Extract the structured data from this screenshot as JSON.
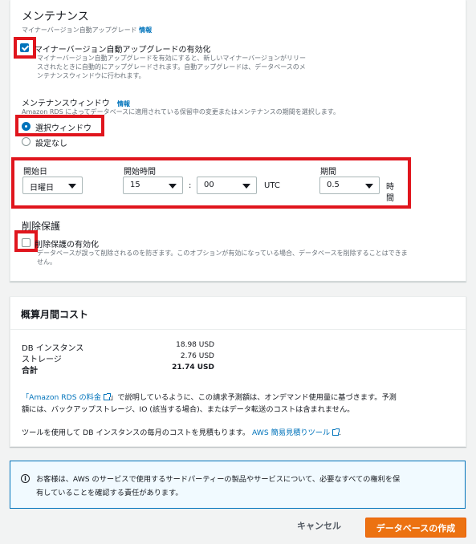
{
  "maintenance": {
    "title": "メンテナンス",
    "subtitle": "マイナーバージョン自動アップグレード",
    "info_link": "情報",
    "auto_upgrade": {
      "label": "マイナーバージョン自動アップグレードの有効化",
      "checked": true,
      "desc_line1": "マイナーバージョン自動アップグレードを有効にすると、新しいマイナーバージョンがリリー",
      "desc_line2": "スされたときに自動的にアップグレードされます。自動アップグレードは、データベースのメ",
      "desc_line3": "ンテナンスウィンドウに行われます。"
    },
    "window": {
      "title": "メンテナンスウィンドウ",
      "info_link": "情報",
      "desc": "Amazon RDS によってデータベースに適用されている保留中の変更またはメンテナンスの期間を選択します。",
      "option_select": "選択ウィンドウ",
      "option_none": "設定なし",
      "selected": "選択ウィンドウ"
    },
    "schedule": {
      "start_day_label": "開始日",
      "start_day_value": "日曜日",
      "start_time_label": "開始時間",
      "hour_value": "15",
      "separator": ":",
      "minute_value": "00",
      "timezone": "UTC",
      "duration_label": "期間",
      "duration_value": "0.5",
      "duration_unit_1": "時",
      "duration_unit_2": "間"
    }
  },
  "deletion": {
    "title": "削除保護",
    "label": "削除保護の有効化",
    "checked": false,
    "desc_line1": "データベースが誤って削除されるのを防ぎます。このオプションが有効になっている場合、データベースを削除することはできま",
    "desc_line2": "せん。"
  },
  "cost": {
    "title": "概算月間コスト",
    "rows": [
      {
        "label": "DB インスタンス",
        "value": "18.98 USD"
      },
      {
        "label": "ストレージ",
        "value": "2.76 USD"
      },
      {
        "label": "合計",
        "value": "21.74 USD"
      }
    ],
    "pricing_link": "「Amazon RDS の料金",
    "text_line1_rest": "」で説明しているように、この請求予測額は、オンデマンド使用量に基づきます。予測",
    "text_line2": "額には、バックアップストレージ、IO (該当する場合)、またはデータ転送のコストは含まれません。",
    "calculator_prefix": "ツールを使用して DB インスタンスの毎月のコストを見積もります。",
    "calculator_link": "AWS 簡易見積りツール",
    "calculator_suffix": "."
  },
  "notice": {
    "line1": "お客様は、AWS のサービスで使用するサードパーティーの製品やサービスについて、必要なすべての権利を保",
    "line2": "有していることを確認する責任があります。"
  },
  "footer": {
    "cancel": "キャンセル",
    "create": "データベースの作成"
  }
}
